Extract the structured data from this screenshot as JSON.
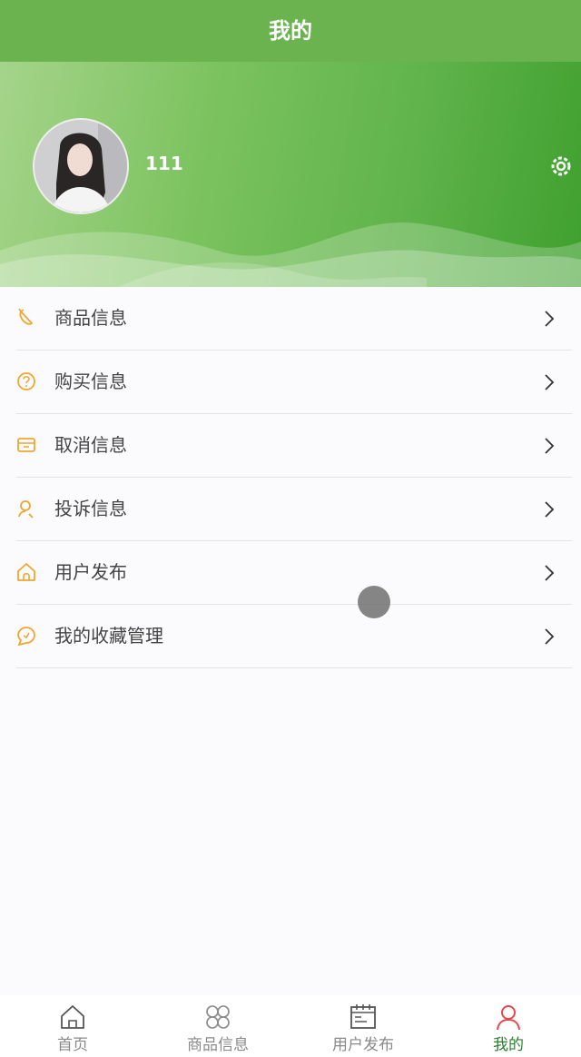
{
  "navbar": {
    "title": "我的"
  },
  "profile": {
    "username": "111"
  },
  "menu": [
    {
      "label": "商品信息",
      "icon": "carrot-icon"
    },
    {
      "label": "购买信息",
      "icon": "question-circle-icon"
    },
    {
      "label": "取消信息",
      "icon": "store-icon"
    },
    {
      "label": "投诉信息",
      "icon": "user-icon"
    },
    {
      "label": "用户发布",
      "icon": "home-icon"
    },
    {
      "label": "我的收藏管理",
      "icon": "chat-bubble-icon"
    }
  ],
  "tabbar": [
    {
      "label": "首页",
      "icon": "home-icon"
    },
    {
      "label": "商品信息",
      "icon": "grid-icon"
    },
    {
      "label": "用户发布",
      "icon": "calendar-icon"
    },
    {
      "label": "我的",
      "icon": "person-icon",
      "active": true
    }
  ],
  "colors": {
    "accent": "#6ab34e",
    "menu_icon": "#f0a630",
    "tab_active": "#e5484d"
  }
}
